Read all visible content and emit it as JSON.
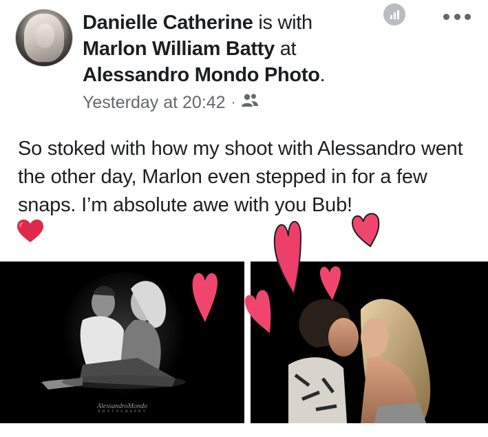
{
  "post": {
    "author": "Danielle Catherine",
    "with_text": " is with ",
    "tagged": "Marlon William Batty",
    "at_text": " at ",
    "location": "Alessandro Mondo Photo",
    "period": ".",
    "timestamp": "Yesterday at 20:42",
    "separator": "·",
    "body": "So stoked with how my shoot with Alessandro went the other day, Marlon even stepped in for a few snaps. I’m absolute awe with you Bub!",
    "watermark_line1": "AlessandroMondo",
    "watermark_line2": "P H O T O G R A P H Y"
  },
  "icons": {
    "audience": "friends-icon",
    "insights": "insights-icon",
    "more": "more-options-icon",
    "emoji": "red-heart-emoji"
  },
  "colors": {
    "text": "#1c1e21",
    "secondary": "#65676b",
    "heart_red": "#e0284a",
    "deco_pink": "#f0466e"
  }
}
